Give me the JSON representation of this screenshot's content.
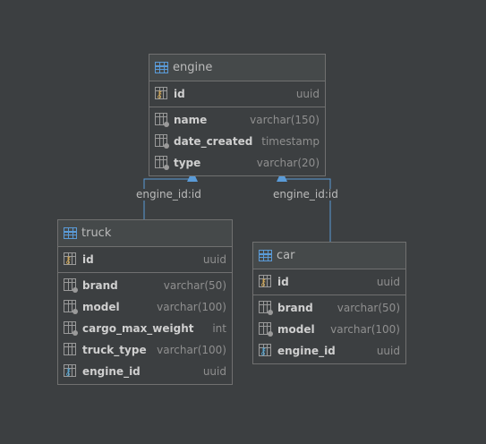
{
  "colors": {
    "background": "#3c3f41",
    "border": "#707070",
    "connector": "#5a9bd8",
    "pk_key": "#d6a84f",
    "fk_key": "#4fa6d6"
  },
  "tables": {
    "engine": {
      "name": "engine",
      "pk": [
        {
          "name": "id",
          "type": "uuid",
          "icon": "primary-key-icon"
        }
      ],
      "columns": [
        {
          "name": "name",
          "type": "varchar(150)",
          "icon": "column-icon"
        },
        {
          "name": "date_created",
          "type": "timestamp",
          "icon": "column-icon"
        },
        {
          "name": "type",
          "type": "varchar(20)",
          "icon": "column-icon"
        }
      ]
    },
    "truck": {
      "name": "truck",
      "pk": [
        {
          "name": "id",
          "type": "uuid",
          "icon": "primary-key-icon"
        }
      ],
      "columns": [
        {
          "name": "brand",
          "type": "varchar(50)",
          "icon": "column-icon"
        },
        {
          "name": "model",
          "type": "varchar(100)",
          "icon": "column-icon"
        },
        {
          "name": "cargo_max_weight",
          "type": "int",
          "icon": "column-icon"
        },
        {
          "name": "truck_type",
          "type": "varchar(100)",
          "icon": "column-icon"
        },
        {
          "name": "engine_id",
          "type": "uuid",
          "icon": "foreign-key-icon"
        }
      ]
    },
    "car": {
      "name": "car",
      "pk": [
        {
          "name": "id",
          "type": "uuid",
          "icon": "primary-key-icon"
        }
      ],
      "columns": [
        {
          "name": "brand",
          "type": "varchar(50)",
          "icon": "column-icon"
        },
        {
          "name": "model",
          "type": "varchar(100)",
          "icon": "column-icon"
        },
        {
          "name": "engine_id",
          "type": "uuid",
          "icon": "foreign-key-icon"
        }
      ]
    }
  },
  "edges": {
    "truck_engine": {
      "label": "engine_id:id"
    },
    "car_engine": {
      "label": "engine_id:id"
    }
  }
}
